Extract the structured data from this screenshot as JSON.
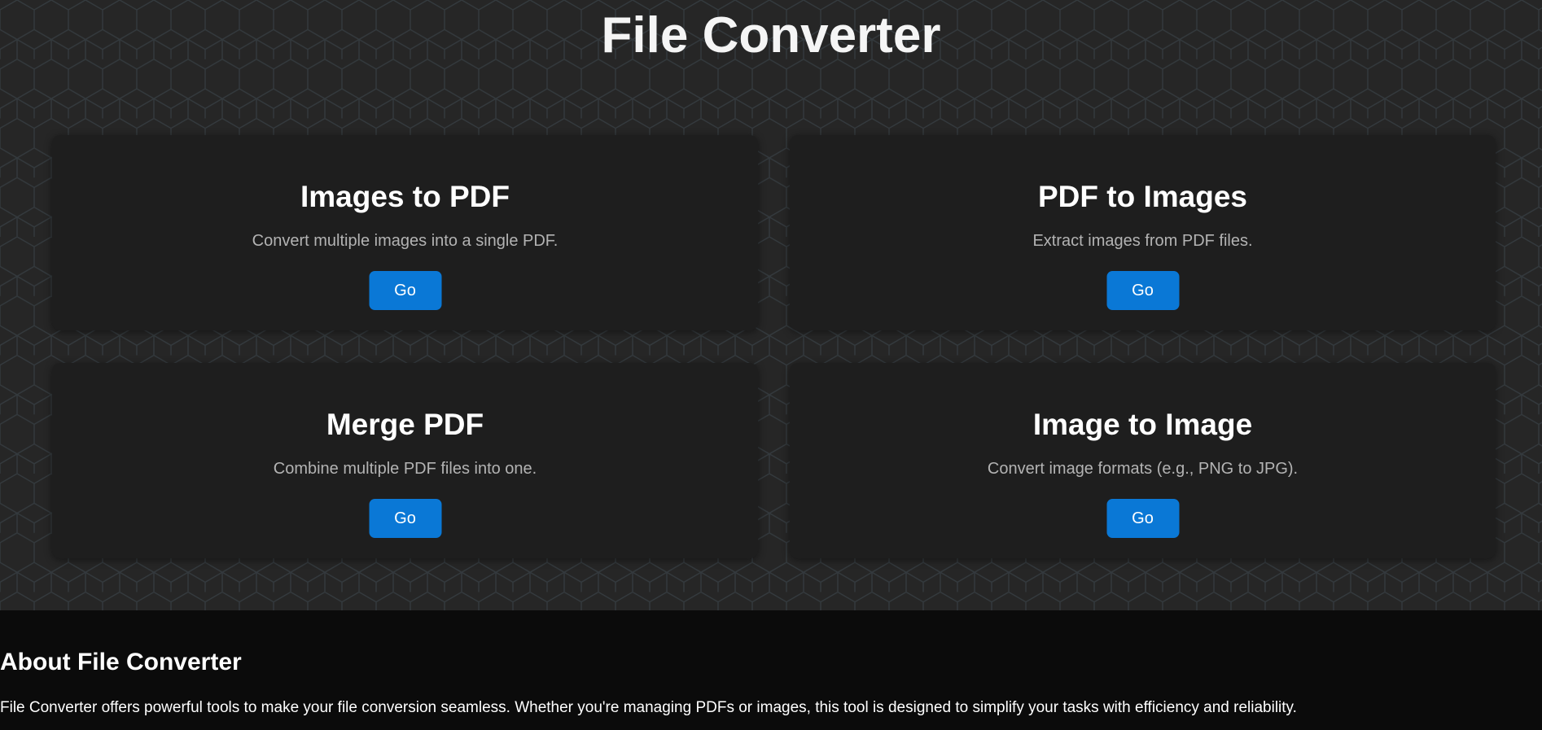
{
  "header": {
    "title": "File Converter"
  },
  "tools": [
    {
      "title": "Images to PDF",
      "description": "Convert multiple images into a single PDF.",
      "button_label": "Go"
    },
    {
      "title": "PDF to Images",
      "description": "Extract images from PDF files.",
      "button_label": "Go"
    },
    {
      "title": "Merge PDF",
      "description": "Combine multiple PDF files into one.",
      "button_label": "Go"
    },
    {
      "title": "Image to Image",
      "description": "Convert image formats (e.g., PNG to JPG).",
      "button_label": "Go"
    }
  ],
  "about": {
    "title": "About File Converter",
    "text": "File Converter offers powerful tools to make your file conversion seamless. Whether you're managing PDFs or images, this tool is designed to simplify your tasks with efficiency and reliability."
  },
  "colors": {
    "background": "#262626",
    "card": "#1e1e1e",
    "accent_button": "#0a78d6",
    "footer": "#0b0b0b",
    "hex_line": "#343a3e"
  }
}
